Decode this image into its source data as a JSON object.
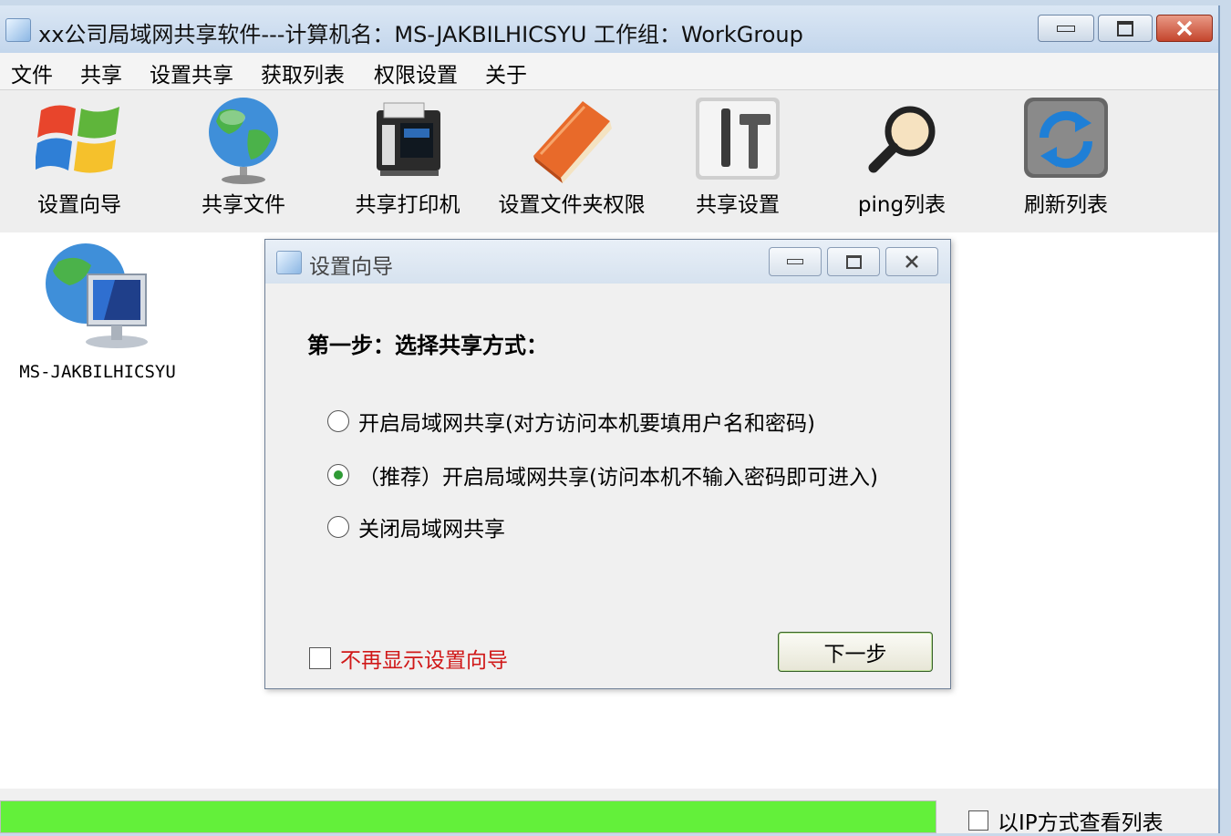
{
  "window": {
    "title": "xx公司局域网共享软件---计算机名：MS-JAKBILHICSYU  工作组：WorkGroup",
    "controls": [
      "minimize-icon",
      "restore-icon",
      "close-icon"
    ]
  },
  "menu": [
    "文件",
    "共享",
    "设置共享",
    "获取列表",
    "权限设置",
    "关于"
  ],
  "toolbar": [
    {
      "label": "设置向导",
      "icon": "windows-logo-icon"
    },
    {
      "label": "共享文件",
      "icon": "globe-icon"
    },
    {
      "label": "共享打印机",
      "icon": "printer-icon"
    },
    {
      "label": "设置文件夹权限",
      "icon": "book-icon"
    },
    {
      "label": "共享设置",
      "icon": "tools-icon"
    },
    {
      "label": "ping列表",
      "icon": "magnifier-icon"
    },
    {
      "label": "刷新列表",
      "icon": "refresh-icon"
    }
  ],
  "computers": [
    {
      "name": "MS-JAKBILHICSYU",
      "icon": "network-computer-icon"
    }
  ],
  "status": {
    "progress_percent": 100,
    "progress_color": "#63f03a",
    "ip_view_label": "以IP方式查看列表",
    "ip_view_checked": false
  },
  "dialog": {
    "title": "设置向导",
    "step_title": "第一步：选择共享方式：",
    "options": [
      {
        "label": "开启局域网共享(对方访问本机要填用户名和密码)",
        "selected": false
      },
      {
        "label": "（推荐）开启局域网共享(访问本机不输入密码即可进入)",
        "selected": true
      },
      {
        "label": "关闭局域网共享",
        "selected": false
      }
    ],
    "dont_show_label": "不再显示设置向导",
    "dont_show_checked": false,
    "next_button": "下一步"
  }
}
